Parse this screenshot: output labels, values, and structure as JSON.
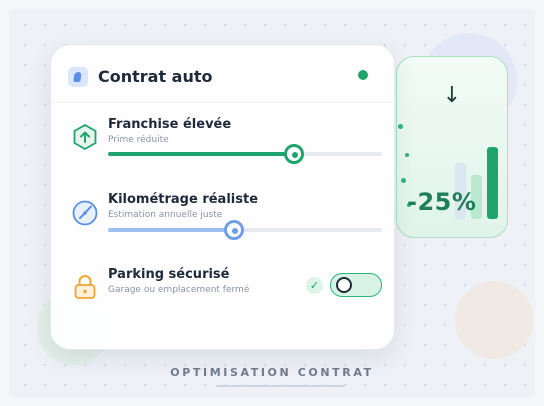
{
  "card": {
    "title": "Contrat auto",
    "status_color": "#1fa56b"
  },
  "options": [
    {
      "label": "Franchise élevée",
      "subtitle": "Prime réduite",
      "icon": "arrow-up-hexagon-icon",
      "control": "slider",
      "value_fraction": 0.68,
      "color": "#1fa56b"
    },
    {
      "label": "Kilométrage réaliste",
      "subtitle": "Estimation annuelle juste",
      "icon": "gauge-icon",
      "control": "slider",
      "value_fraction": 0.46,
      "color": "#6e9fe6"
    },
    {
      "label": "Parking sécurisé",
      "subtitle": "Garage ou emplacement fermé",
      "icon": "padlock-icon",
      "control": "toggle",
      "toggle_on": true,
      "check_icon": "check-icon",
      "color": "#1fa56b"
    }
  ],
  "saving": {
    "arrow_icon": "arrow-down-icon",
    "percent": "-25%",
    "bar_levels": [
      0.78,
      0.61,
      1.0
    ]
  },
  "footer": {
    "caption": "OPTIMISATION CONTRAT"
  }
}
